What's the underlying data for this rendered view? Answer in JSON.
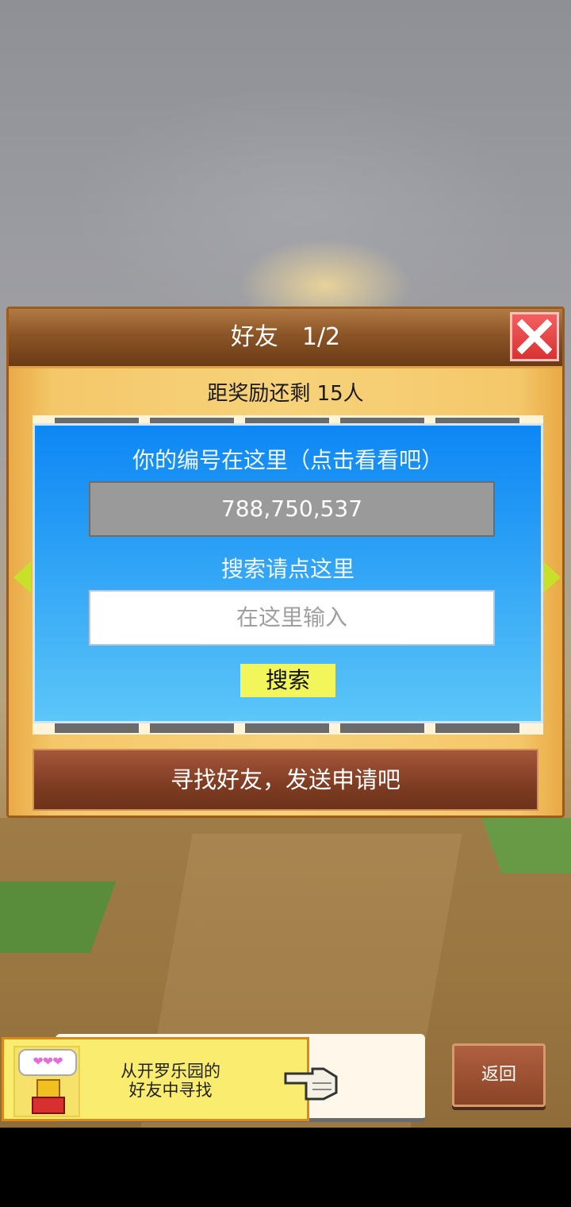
{
  "dialog": {
    "title": "好友　1/2",
    "reward_text": "距奖励还剩 15人",
    "id_label": "你的编号在这里（点击看看吧）",
    "player_id": "788,750,537",
    "search_label": "搜索请点这里",
    "search_placeholder": "在这里输入",
    "search_button": "搜索",
    "find_friends_button": "寻找好友，发送申请吧"
  },
  "banner": {
    "text_line1": "从开罗乐园的",
    "text_line2": "好友中寻找",
    "hearts": "❤❤❤"
  },
  "back_button": "返回",
  "colors": {
    "panel_blue": "#0d87f5",
    "close_red": "#d83232",
    "search_button_yellow": "#f2f65a",
    "arrow_green": "#c9e02a"
  }
}
